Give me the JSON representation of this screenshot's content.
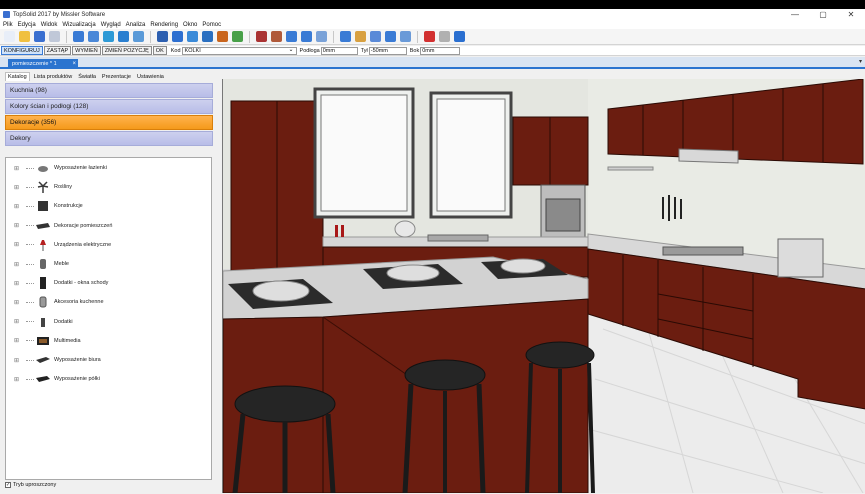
{
  "app": {
    "title": "TopSolid 2017 by Missler Software"
  },
  "window_controls": {
    "minimize": "—",
    "maximize": "▢",
    "close": "✕"
  },
  "menu": [
    "Plik",
    "Edycja",
    "Widok",
    "Wizualizacja",
    "Wygląd",
    "Analiza",
    "Rendering",
    "Okno",
    "Pomoc"
  ],
  "toolbar_icons": [
    {
      "name": "new-file-icon",
      "color": "#e8eef8"
    },
    {
      "name": "open-folder-icon",
      "color": "#f0c040"
    },
    {
      "name": "save-icon",
      "color": "#3a6fd0"
    },
    {
      "name": "cut-icon",
      "color": "#c0c8d8"
    },
    {
      "name": "undo-icon",
      "color": "#3a7bd5"
    },
    {
      "name": "delete-icon",
      "color": "#4a88d8"
    },
    {
      "name": "select-icon",
      "color": "#2e9ad6"
    },
    {
      "name": "move-icon",
      "color": "#2a7fd0"
    },
    {
      "name": "copy-icon",
      "color": "#5a9ad8"
    },
    {
      "name": "align-icon",
      "color": "#2d5fb0"
    },
    {
      "name": "link-icon",
      "color": "#2d6fd0"
    },
    {
      "name": "measure-icon",
      "color": "#3a8ad8"
    },
    {
      "name": "hierarchy-icon",
      "color": "#2a6fc0"
    },
    {
      "name": "paint-icon",
      "color": "#c9651d"
    },
    {
      "name": "material-icon",
      "color": "#48a048"
    },
    {
      "name": "book-icon",
      "color": "#a33"
    },
    {
      "name": "wood-icon",
      "color": "#b05a3a"
    },
    {
      "name": "curve-icon",
      "color": "#3a7bd5"
    },
    {
      "name": "rotate-icon",
      "color": "#3a7bd5"
    },
    {
      "name": "cube-icon",
      "color": "#7aa2d8"
    },
    {
      "name": "tag-icon",
      "color": "#3a7bd5"
    },
    {
      "name": "render-icon",
      "color": "#d8a040"
    },
    {
      "name": "view-icon",
      "color": "#5a8ad8"
    },
    {
      "name": "camera-icon",
      "color": "#3a7bd5"
    },
    {
      "name": "display-icon",
      "color": "#6a9ad8"
    },
    {
      "name": "close-red-icon",
      "color": "#d23030"
    },
    {
      "name": "settings-icon",
      "color": "#b0b0b0"
    },
    {
      "name": "help-icon",
      "color": "#2a6fd0"
    }
  ],
  "cmdbar": {
    "buttons": [
      "KONFIGURUJ",
      "ZASTĄP",
      "WYMIEŃ",
      "ZMIEŃ POZYCJĘ",
      "OK"
    ],
    "kod_label": "Kod",
    "kod_value": "KOLKI",
    "podloga_label": "Podłoga",
    "podloga_value": "0mm",
    "tyl_label": "Tył",
    "tyl_value": "-50mm",
    "bok_label": "Bok",
    "bok_value": "0mm"
  },
  "document_tab": {
    "label": "pomieszczenie * 1",
    "close": "×"
  },
  "panel": {
    "tabs": [
      "Katalog",
      "Lista produktów",
      "Światła",
      "Prezentacje",
      "Ustawienia"
    ],
    "categories": [
      {
        "label": "Kuchnia (98)",
        "active": false
      },
      {
        "label": "Kolory ścian i podłogi (128)",
        "active": false
      },
      {
        "label": "Dekoracje (356)",
        "active": true
      },
      {
        "label": "Dekory",
        "active": false
      }
    ],
    "tree": [
      {
        "label": "Wyposażenie łazienki",
        "icon": "sink-icon"
      },
      {
        "label": "Rośliny",
        "icon": "plant-icon"
      },
      {
        "label": "Konstrukcje",
        "icon": "construction-icon"
      },
      {
        "label": "Dekoracje pomieszczeń",
        "icon": "decoration-icon"
      },
      {
        "label": "Urządzenia elektryczne",
        "icon": "lamp-icon"
      },
      {
        "label": "Meble",
        "icon": "chair-icon"
      },
      {
        "label": "Dodatki - okna schody",
        "icon": "door-icon"
      },
      {
        "label": "Akcesoria kuchenne",
        "icon": "bottle-icon"
      },
      {
        "label": "Dodatki",
        "icon": "vase-icon"
      },
      {
        "label": "Multimedia",
        "icon": "tv-icon"
      },
      {
        "label": "Wyposażenie biura",
        "icon": "desk-icon"
      },
      {
        "label": "Wyposażenie półki",
        "icon": "shelf-icon"
      }
    ],
    "footer_checkbox": "Tryb uproszczony"
  },
  "scene": {
    "cabinet_color": "#6b1d10",
    "wall_color": "#e4e6e0",
    "counter_color": "#c9c9c9",
    "floor_color": "#ececec"
  }
}
